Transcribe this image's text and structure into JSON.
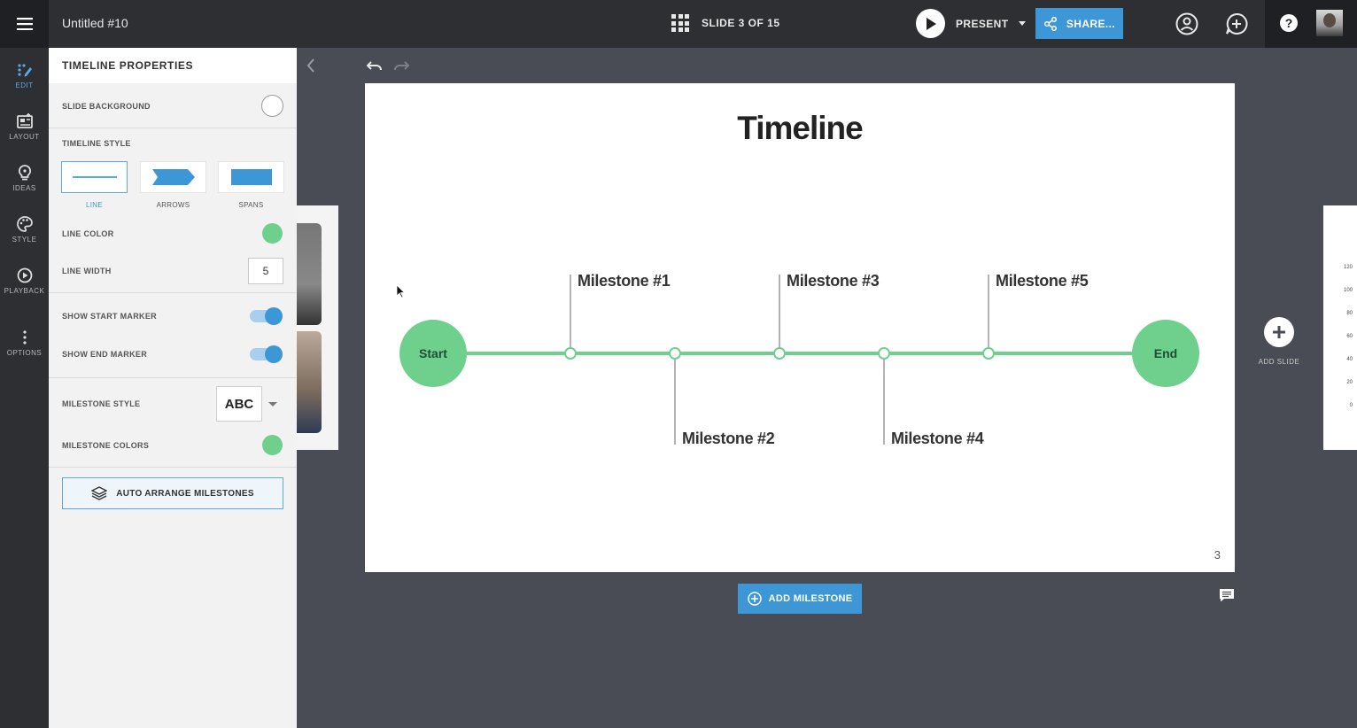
{
  "topbar": {
    "doc_title": "Untitled #10",
    "slide_counter": "SLIDE 3 OF 15",
    "present_label": "PRESENT",
    "share_label": "SHARE..."
  },
  "nav": [
    {
      "label": "EDIT",
      "icon": "edit-icon",
      "active": true
    },
    {
      "label": "LAYOUT",
      "icon": "layout-icon"
    },
    {
      "label": "IDEAS",
      "icon": "lightbulb-icon"
    },
    {
      "label": "STYLE",
      "icon": "palette-icon"
    },
    {
      "label": "PLAYBACK",
      "icon": "play-circle-icon"
    },
    {
      "label": "OPTIONS",
      "icon": "more-vertical-icon"
    }
  ],
  "panel": {
    "title": "TIMELINE PROPERTIES",
    "slide_background_label": "SLIDE BACKGROUND",
    "timeline_style_label": "TIMELINE STYLE",
    "style_options": [
      {
        "label": "LINE",
        "selected": true
      },
      {
        "label": "ARROWS"
      },
      {
        "label": "SPANS"
      }
    ],
    "line_color_label": "LINE COLOR",
    "line_color": "#6fd08e",
    "line_width_label": "LINE WIDTH",
    "line_width": "5",
    "show_start_marker_label": "SHOW START MARKER",
    "show_start_marker": true,
    "show_end_marker_label": "SHOW END MARKER",
    "show_end_marker": true,
    "milestone_style_label": "MILESTONE STYLE",
    "milestone_style_value": "ABC",
    "milestone_colors_label": "MILESTONE COLORS",
    "milestone_color": "#6fd08e",
    "auto_arrange_label": "AUTO ARRANGE MILESTONES"
  },
  "slide": {
    "title": "Timeline",
    "start_label": "Start",
    "end_label": "End",
    "milestones": [
      {
        "label": "Milestone #1",
        "position": "above"
      },
      {
        "label": "Milestone #2",
        "position": "below"
      },
      {
        "label": "Milestone #3",
        "position": "above"
      },
      {
        "label": "Milestone #4",
        "position": "below"
      },
      {
        "label": "Milestone #5",
        "position": "above"
      }
    ],
    "number": "3"
  },
  "canvas": {
    "add_milestone_label": "ADD MILESTONE",
    "add_slide_label": "ADD SLIDE",
    "next_slide_ticks": [
      "120",
      "100",
      "80",
      "60",
      "40",
      "20",
      "0"
    ]
  },
  "colors": {
    "accent": "#3d97d7",
    "timeline_green": "#6fd08e",
    "topbar": "#2e2f33",
    "canvas_bg": "#4a4c55"
  }
}
